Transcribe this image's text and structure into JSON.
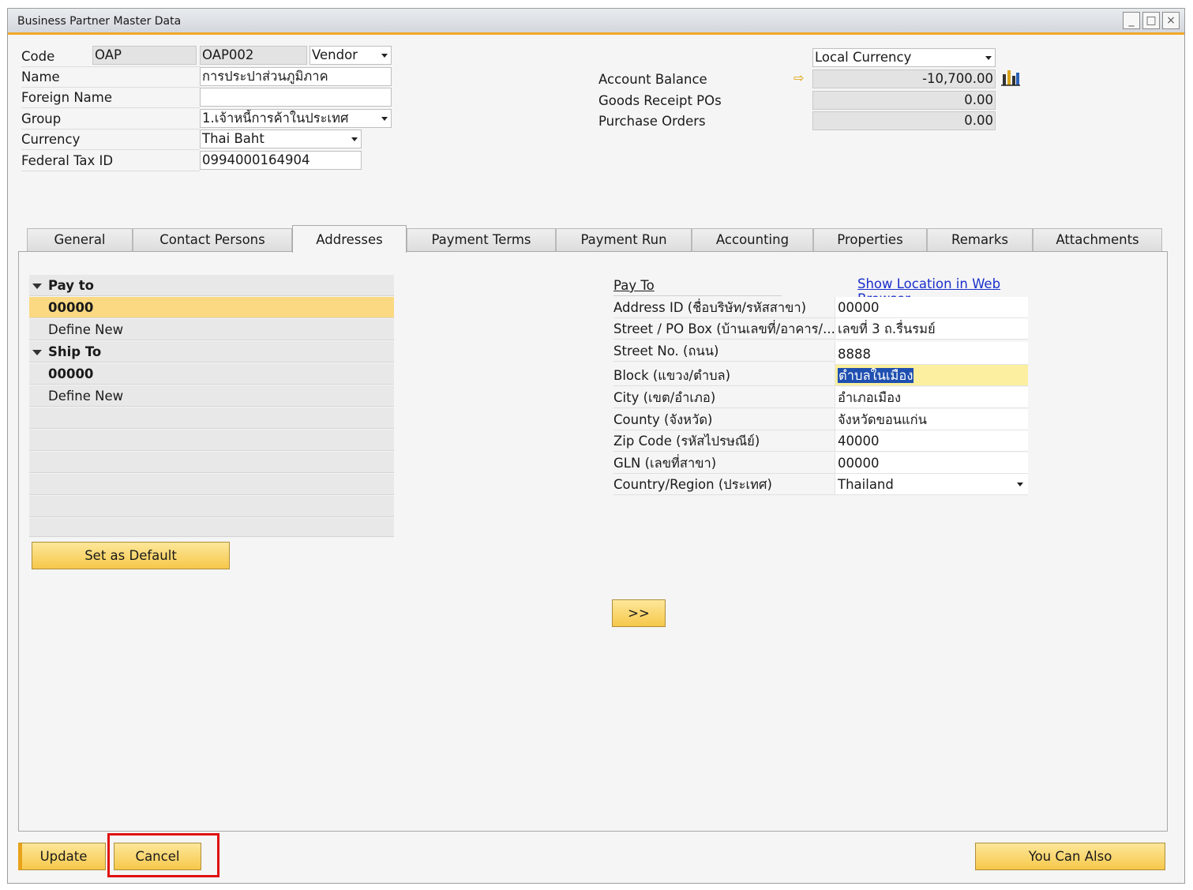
{
  "window": {
    "title": "Business Partner Master Data",
    "buttons": [
      "_",
      "□",
      "×"
    ]
  },
  "header": {
    "code_label": "Code",
    "code_series": "OAP",
    "code_value": "OAP002",
    "bp_type": "Vendor",
    "name_label": "Name",
    "name_value": "การประปาส่วนภูมิภาค",
    "foreign_name_label": "Foreign Name",
    "foreign_name_value": "",
    "group_label": "Group",
    "group_value": "1.เจ้าหนี้การค้าในประเทศ",
    "currency_label": "Currency",
    "currency_value": "Thai Baht",
    "tax_label": "Federal Tax ID",
    "tax_value": "0994000164904"
  },
  "balances": {
    "currency_select": "Local Currency",
    "account_balance_label": "Account Balance",
    "account_balance": "-10,700.00",
    "goods_receipt_label": "Goods Receipt POs",
    "goods_receipt": "0.00",
    "purchase_orders_label": "Purchase Orders",
    "purchase_orders": "0.00"
  },
  "tabs": [
    "General",
    "Contact Persons",
    "Addresses",
    "Payment Terms",
    "Payment Run",
    "Accounting",
    "Properties",
    "Remarks",
    "Attachments"
  ],
  "tree": {
    "pay_to": "Pay to",
    "pay_to_code": "00000",
    "pay_to_new": "Define New",
    "ship_to": "Ship To",
    "ship_to_code": "00000",
    "ship_to_new": "Define New"
  },
  "set_default_label": "Set as Default",
  "address": {
    "heading": "Pay To",
    "web_link": "Show Location in Web Browser",
    "rows": [
      {
        "label": "Address ID (ชื่อบริษัท/รหัสสาขา)",
        "value": "00000"
      },
      {
        "label": "Street / PO Box (บ้านเลขที่/อาคาร/...",
        "value": "เลขที่ 3 ถ.รื่นรมย์"
      },
      {
        "label": "Street No. (ถนน)",
        "value": "8888"
      },
      {
        "label": "Block (แขวง/ตำบล)",
        "value": "ตำบลในเมือง"
      },
      {
        "label": "City (เขต/อำเภอ)",
        "value": "อำเภอเมือง"
      },
      {
        "label": "County (จังหวัด)",
        "value": "จังหวัดขอนแก่น"
      },
      {
        "label": "Zip Code (รหัสไปรษณีย์)",
        "value": "40000"
      },
      {
        "label": "GLN (เลขที่สาขา)",
        "value": "00000"
      },
      {
        "label": "Country/Region (ประเทศ)",
        "value": "Thailand"
      }
    ]
  },
  "expand_label": ">>",
  "footer": {
    "update": "Update",
    "cancel": "Cancel",
    "you_can_also": "You Can Also"
  }
}
